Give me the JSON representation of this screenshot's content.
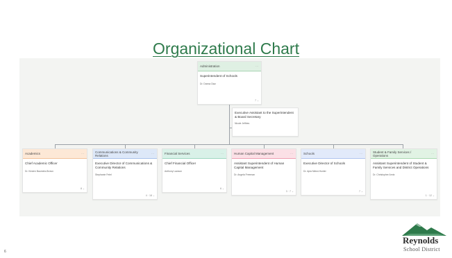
{
  "slide": {
    "title": "Organizational Chart",
    "page_number": "6"
  },
  "org": {
    "top": {
      "department": "Administration",
      "more": "···",
      "role": "Superintendent of Schools",
      "person": "Dr. Danna Diaz",
      "count": "7 ⌄"
    },
    "assistant": {
      "role": "Executive Assistant to the Superintendent & Board Secretary",
      "person": "Nicole Jeffries"
    },
    "departments": [
      {
        "department": "Academics",
        "more": "···",
        "role": "Chief Academic Officer",
        "person": "Dr. Kirsten Baumetz-Brown",
        "count": "8 ⌄"
      },
      {
        "department": "Communications & Community Relations",
        "more": "···",
        "role": "Executive Director of Communications & Community Relations",
        "person": "Stephanie Fetel",
        "count": "4 · 18 ⌄"
      },
      {
        "department": "Financial Services",
        "more": "···",
        "role": "Chief Financial Officer",
        "person": "Anthony Lawson",
        "count": "6 ⌄"
      },
      {
        "department": "Human Capital Management",
        "more": "···",
        "role": "Assistant Superintendent of Human Capital Management",
        "person": "Dr. Angela Freeman",
        "count": "3 · 7 ⌄"
      },
      {
        "department": "Schools",
        "more": "···",
        "role": "Executive Director of Schools",
        "person": "Dr. Apia Meiwi-Hunter",
        "count": "7 ⌄"
      },
      {
        "department": "Student & Family Services / Operations",
        "more": "···",
        "role": "Assistant Superintendent of Student & Family Services and District Operations",
        "person": "Dr. Christopher Arntz",
        "count": "1 · 12 ⌄"
      }
    ]
  },
  "logo": {
    "name": "Reynolds",
    "subtitle": "School District"
  },
  "colors": {
    "title": "#2e7a4b",
    "administration_header": "#dff0e3",
    "academics_header": "#fde8d6",
    "communications_header": "#dde8f8",
    "financial_header": "#d9f1e8",
    "human_capital_header": "#fbe0e6",
    "schools_header": "#e2eafa",
    "student_family_header": "#e1f3e4"
  }
}
